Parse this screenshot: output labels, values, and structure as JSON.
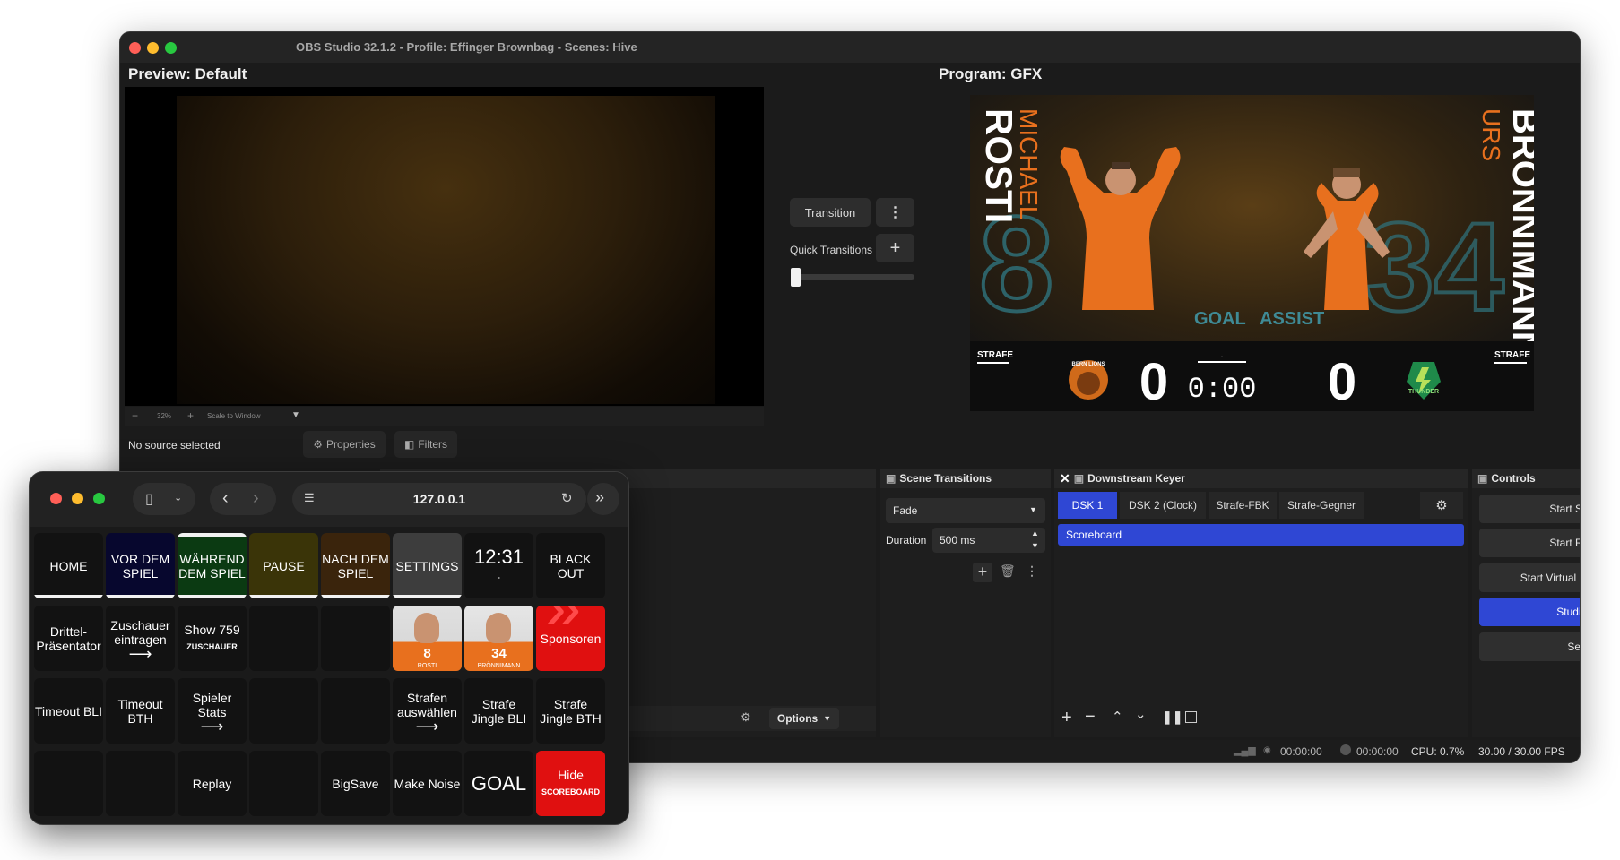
{
  "obs": {
    "title": "OBS Studio 32.1.2 - Profile: Effinger Brownbag - Scenes: Hive",
    "preview_title": "Preview: Default",
    "program_title": "Program: GFX",
    "zoom": "32%",
    "scale_label": "Scale to Window",
    "transition_btn": "Transition",
    "quick_transitions": "Quick Transitions",
    "no_source": "No source selected",
    "properties_btn": "Properties",
    "filters_btn": "Filters",
    "options_btn": "Options",
    "program": {
      "left_first": "MICHAEL",
      "left_last": "ROSTI",
      "left_number": "8",
      "right_first": "URS",
      "right_last": "BRÖNNIMANN",
      "right_number": "34",
      "goal": "GOAL",
      "assist": "ASSIST",
      "strafe_left": "STRAFE",
      "strafe_right": "STRAFE",
      "home_score": "0",
      "away_score": "0",
      "clock": "0:00",
      "period": "-",
      "home_logo_text": "BERN LIONS",
      "away_logo_text": "THUNDER"
    },
    "scene_transitions": {
      "title": "Scene Transitions",
      "type": "Fade",
      "duration_label": "Duration",
      "duration": "500 ms"
    },
    "dsk": {
      "title": "Downstream Keyer",
      "tabs": [
        "DSK 1",
        "DSK 2 (Clock)",
        "Strafe-FBK",
        "Strafe-Gegner"
      ],
      "active_tab": "DSK 1",
      "scene": "Scoreboard"
    },
    "controls": {
      "title": "Controls",
      "start_streaming": "Start Streaming",
      "start_recording": "Start Recording",
      "start_virtual_camera": "Start Virtual Camera",
      "studio_mode": "Studio Mode",
      "settings": "Settings"
    },
    "status": {
      "stream_time": "00:00:00",
      "rec_time": "00:00:00",
      "cpu": "CPU: 0.7%",
      "fps": "30.00 / 30.00 FPS"
    },
    "colors": {
      "accent": "#2f47d4",
      "orange": "#e8701e",
      "teal": "#3f8a95"
    }
  },
  "deck": {
    "url": "127.0.0.1",
    "keys": [
      {
        "label": "HOME",
        "style": "dark",
        "bar": true
      },
      {
        "label": "VOR DEM SPIEL",
        "style": "navy",
        "bar": true
      },
      {
        "label": "WÄHREND DEM SPIEL",
        "style": "green",
        "bar": true,
        "topbar": true
      },
      {
        "label": "PAUSE",
        "style": "olive",
        "bar": true
      },
      {
        "label": "NACH DEM SPIEL",
        "style": "brown",
        "bar": true
      },
      {
        "label": "SETTINGS",
        "style": "gray",
        "bar": true
      },
      {
        "label": "12:31",
        "style": "dark",
        "large": true,
        "sub": "-"
      },
      {
        "label": "BLACK OUT",
        "style": "dark"
      },
      {
        "label": "Drittel-Präsentator",
        "style": "dark"
      },
      {
        "label": "Zuschauer eintragen",
        "style": "dark",
        "arrow": true
      },
      {
        "label": "Show 759",
        "style": "dark",
        "sub": "ZUSCHAUER"
      },
      {
        "label": "",
        "style": "dark"
      },
      {
        "label": "",
        "style": "dark"
      },
      {
        "label": "8",
        "style": "player-orange",
        "sub": "ROSTI"
      },
      {
        "label": "34",
        "style": "player-gray",
        "sub": "BRÖNNIMANN"
      },
      {
        "label": "Sponsoren",
        "style": "red-chevron"
      },
      {
        "label": "Timeout BLI",
        "style": "dark"
      },
      {
        "label": "Timeout BTH",
        "style": "dark"
      },
      {
        "label": "Spieler Stats",
        "style": "dark",
        "arrow": true
      },
      {
        "label": "",
        "style": "dark"
      },
      {
        "label": "",
        "style": "dark"
      },
      {
        "label": "Strafen auswählen",
        "style": "dark",
        "arrow": true
      },
      {
        "label": "Strafe Jingle BLI",
        "style": "dark"
      },
      {
        "label": "Strafe Jingle BTH",
        "style": "dark"
      },
      {
        "label": "",
        "style": "dark"
      },
      {
        "label": "",
        "style": "dark"
      },
      {
        "label": "Replay",
        "style": "dark"
      },
      {
        "label": "",
        "style": "dark"
      },
      {
        "label": "BigSave",
        "style": "dark"
      },
      {
        "label": "Make Noise",
        "style": "dark"
      },
      {
        "label": "GOAL",
        "style": "dark",
        "large": true
      },
      {
        "label": "Hide",
        "style": "red",
        "sub": "SCOREBOARD"
      }
    ]
  }
}
